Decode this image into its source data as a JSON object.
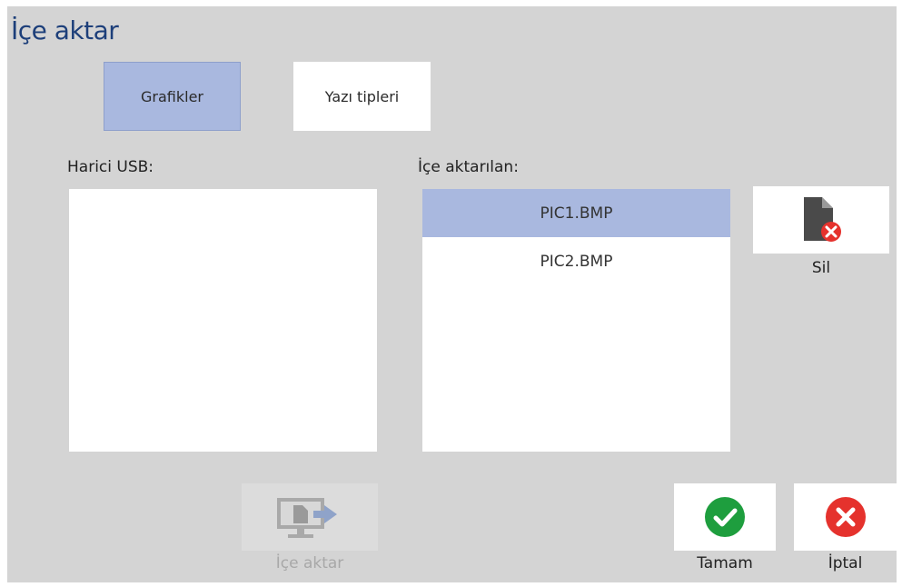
{
  "window": {
    "title": "İçe aktar"
  },
  "tabs": [
    {
      "label": "Grafikler",
      "selected": true
    },
    {
      "label": "Yazı tipleri",
      "selected": false
    }
  ],
  "usb": {
    "label": "Harici USB:",
    "items": []
  },
  "imported": {
    "label": "İçe aktarılan:",
    "items": [
      {
        "name": "PIC1.BMP",
        "selected": true
      },
      {
        "name": "PIC2.BMP",
        "selected": false
      }
    ]
  },
  "buttons": {
    "delete": {
      "label": "Sil",
      "icon": "file-delete-icon"
    },
    "import": {
      "label": "İçe aktar",
      "icon": "import-to-monitor-icon",
      "enabled": false
    },
    "ok": {
      "label": "Tamam",
      "icon": "checkmark-icon"
    },
    "cancel": {
      "label": "İptal",
      "icon": "close-icon"
    }
  },
  "colors": {
    "title": "#1d3f7a",
    "selection": "#a9b8df",
    "ok_green": "#1e9e3e",
    "cancel_red": "#e5322d"
  }
}
